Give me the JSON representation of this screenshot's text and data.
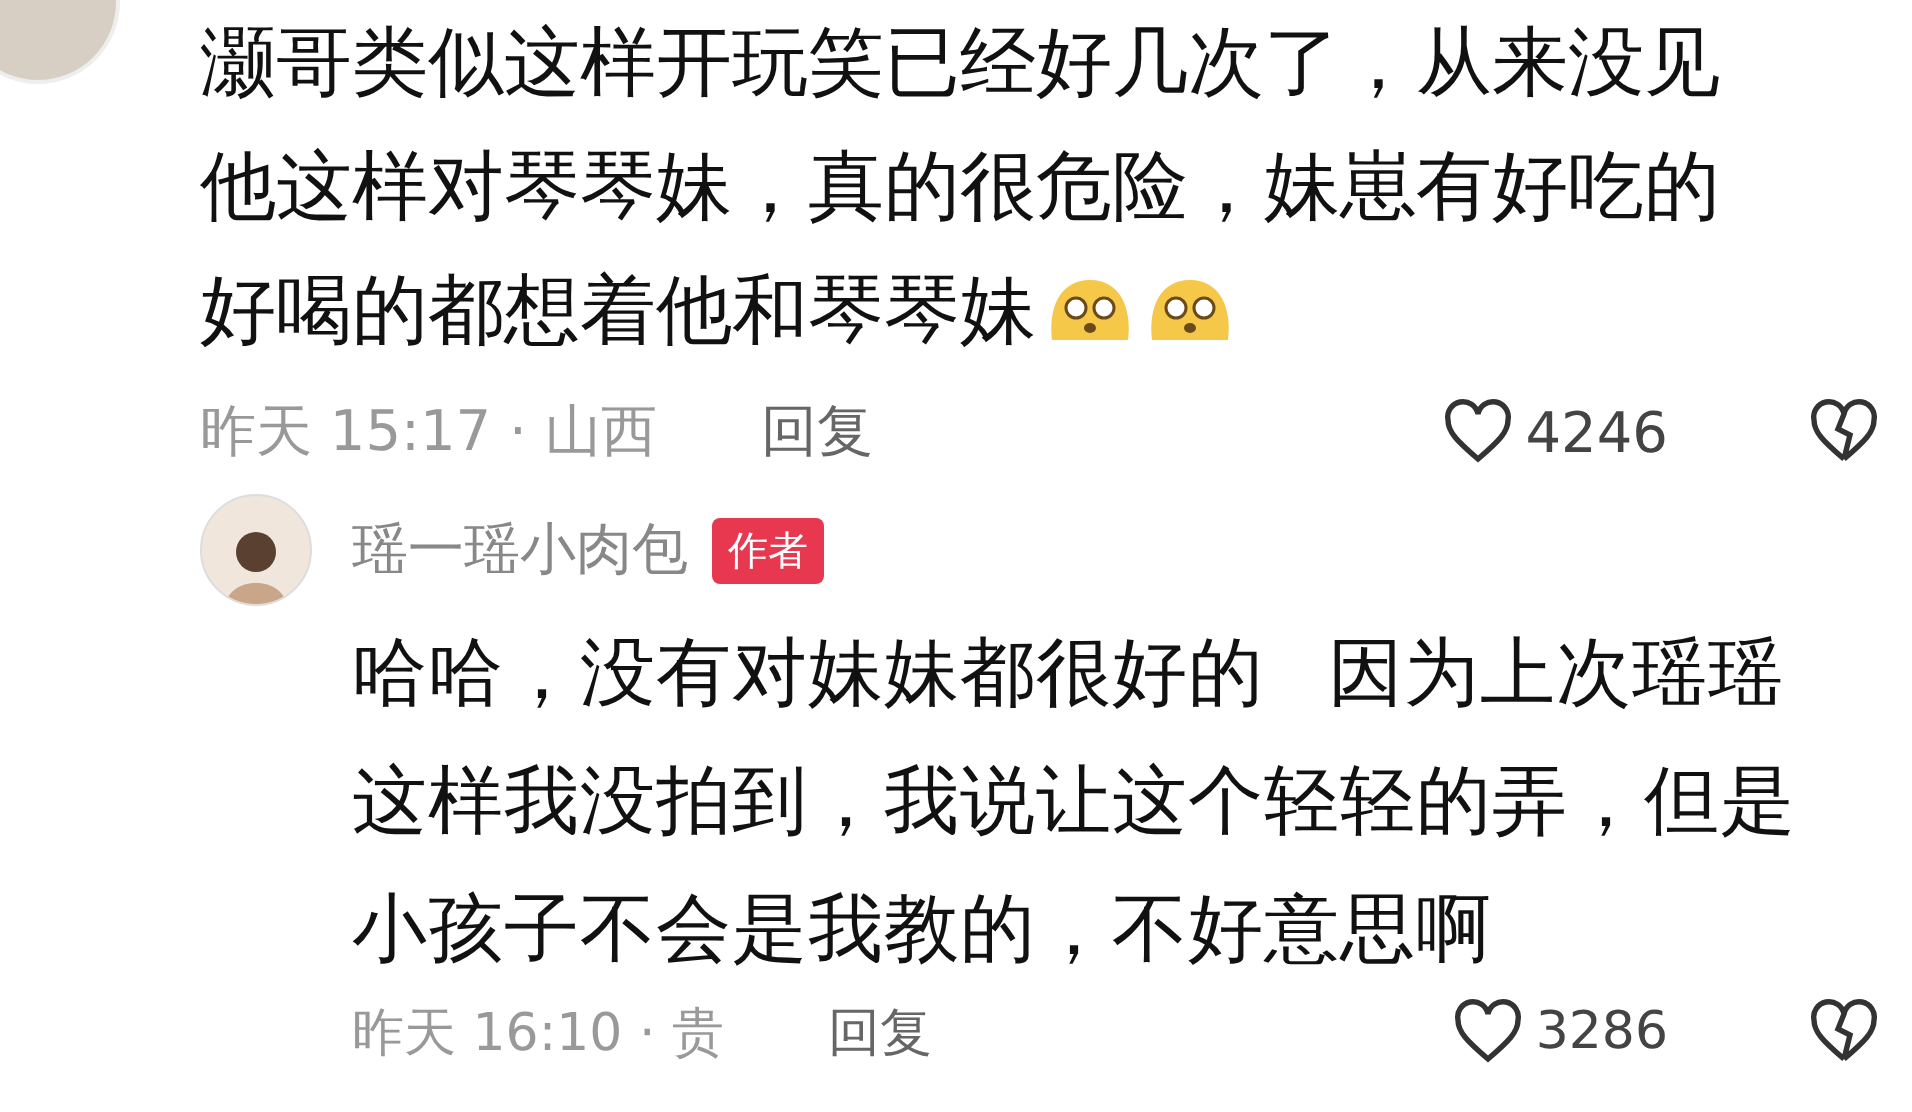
{
  "comments": [
    {
      "text": "灏哥类似这样开玩笑已经好几次了，从来没见他这样对琴琴妹，真的很危险，妹崽有好吃的好喝的都想着他和琴琴妹",
      "emojis": [
        {
          "kind": "worried"
        },
        {
          "kind": "worried"
        }
      ],
      "time": "昨天 15:17 · 山西",
      "reply": "回复",
      "likes": "4246"
    },
    {
      "author": "瑶一瑶小肉包",
      "badge": "作者",
      "text": "哈哈，没有对妹妹都很好的 因为上次瑶瑶这样我没拍到，我说让这个轻轻的弄，但是小孩子不会是我教的，不好意思啊",
      "time": "昨天 16:10 · 贵",
      "reply": "回复",
      "likes": "3286"
    }
  ]
}
